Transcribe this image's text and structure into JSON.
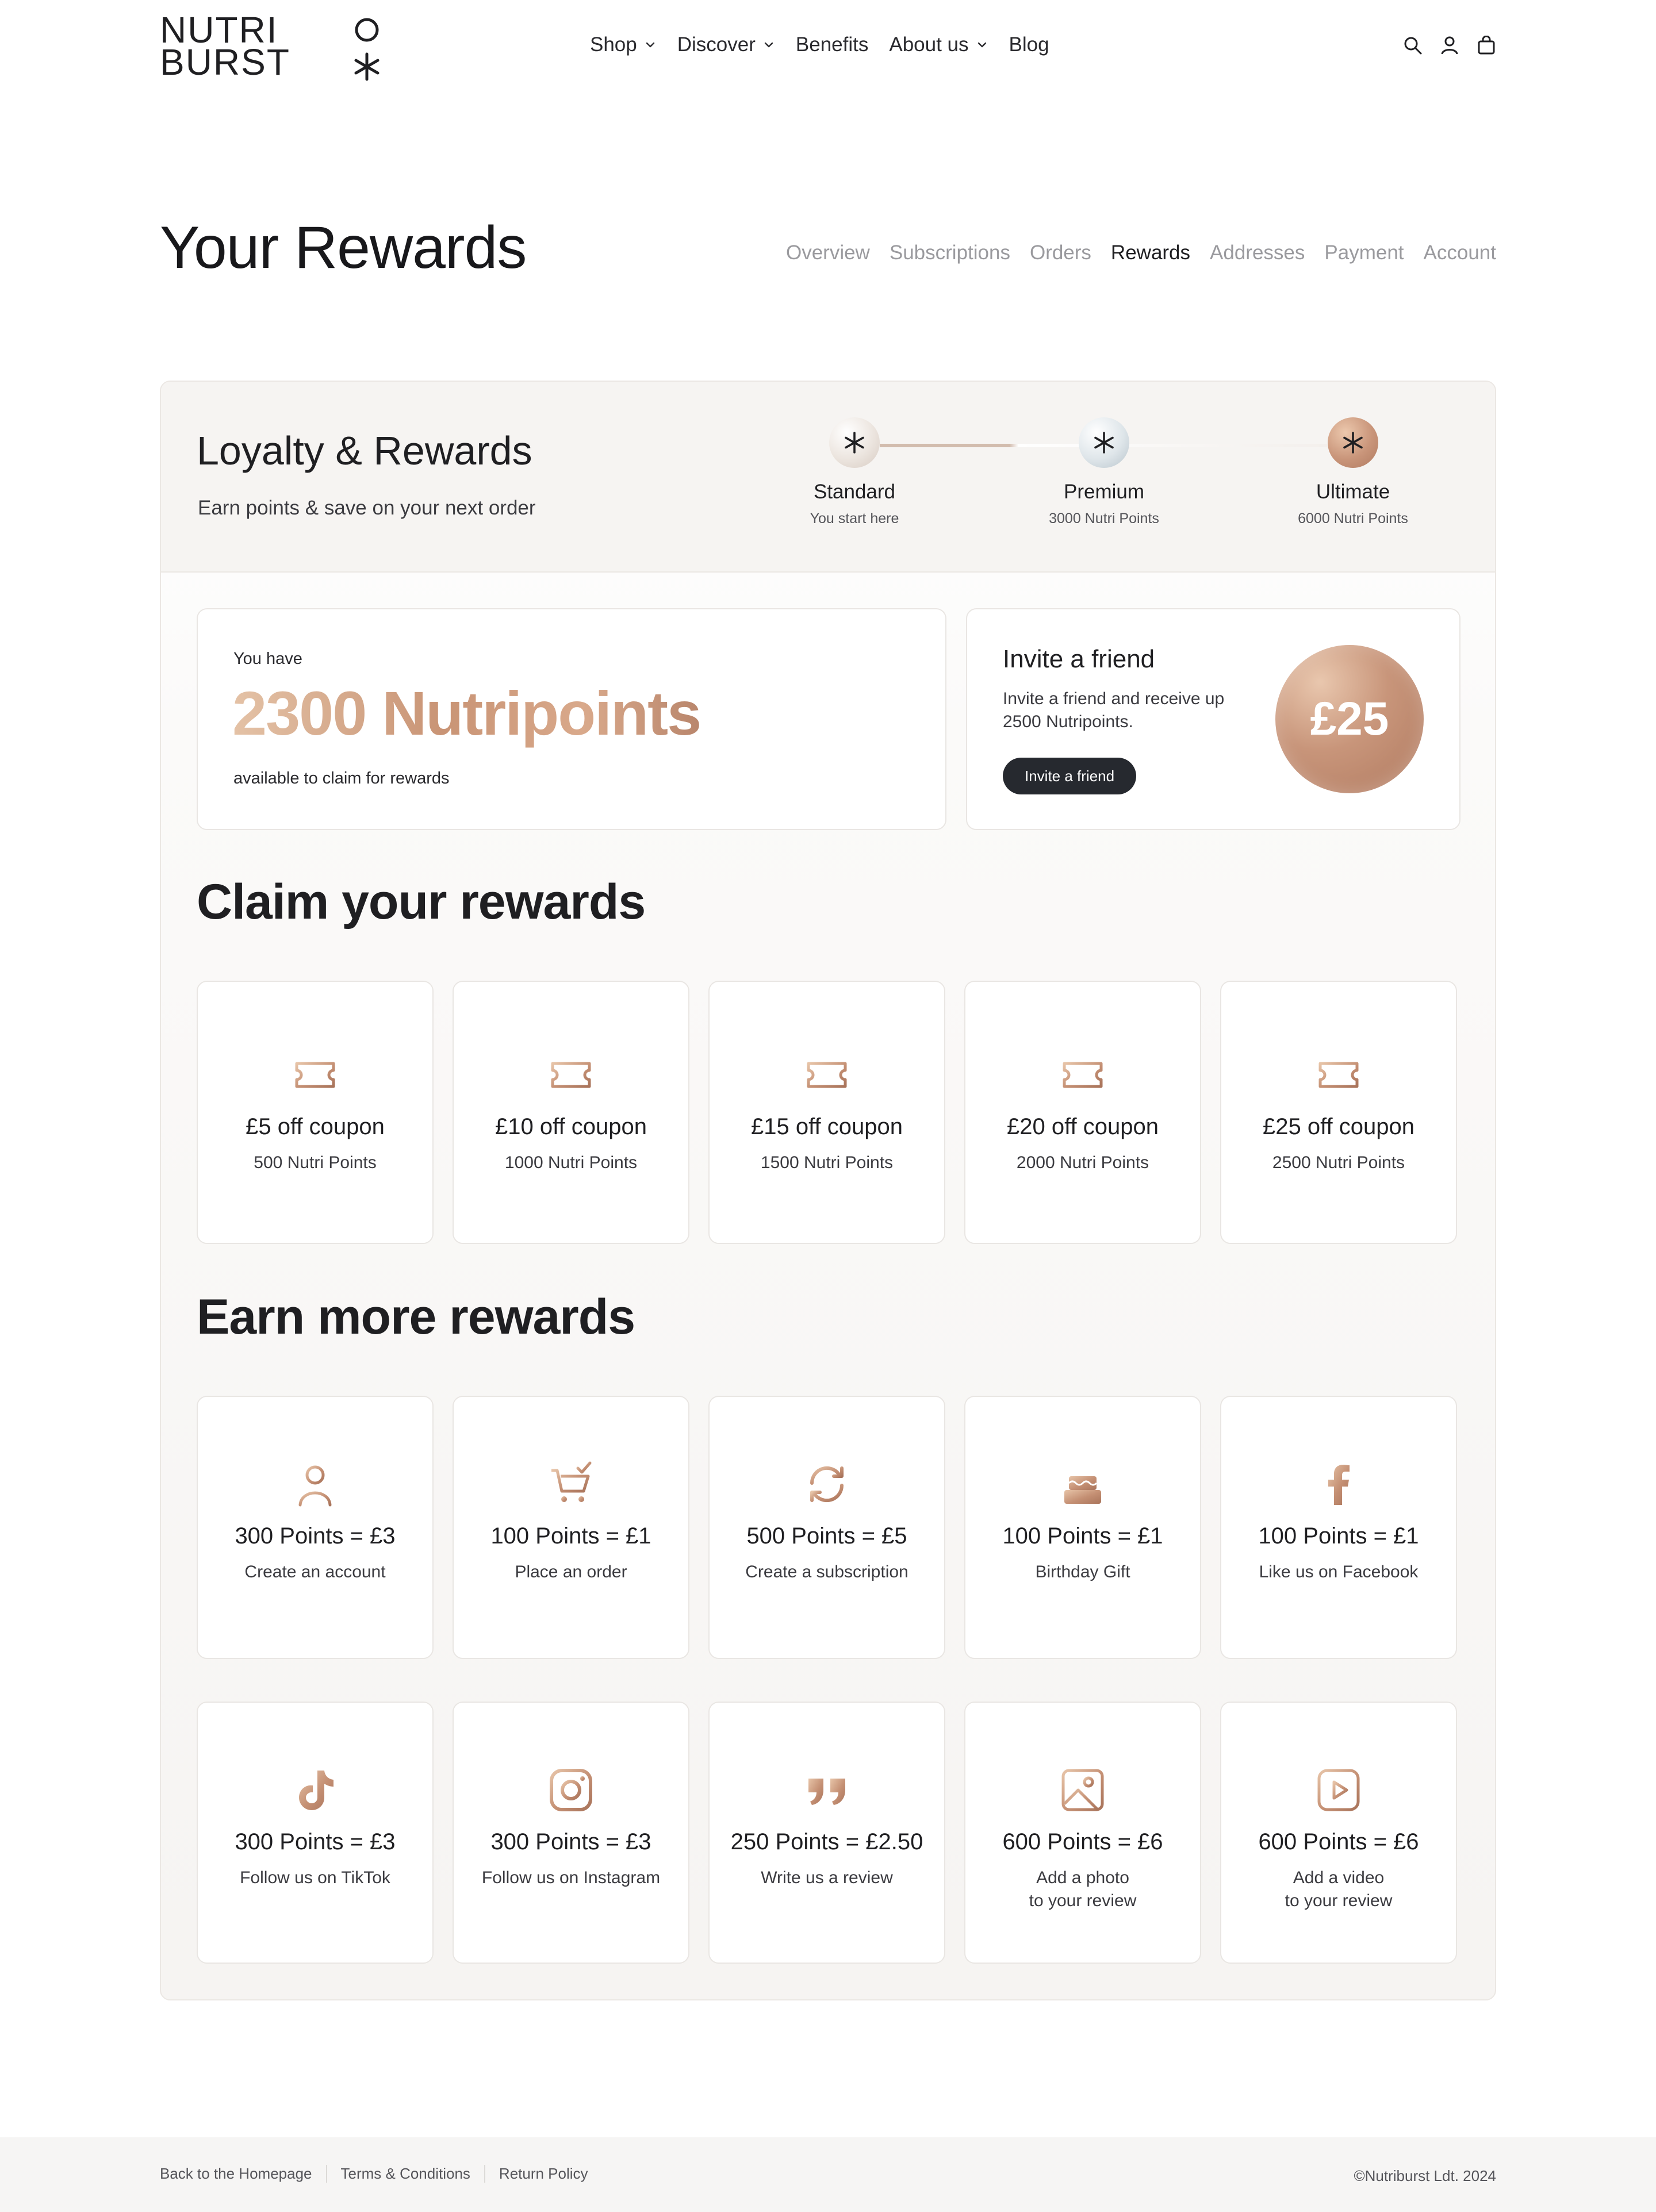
{
  "brand": {
    "line1": "NUTRI",
    "line2": "BURST"
  },
  "nav": {
    "items": [
      {
        "label": "Shop",
        "has_dropdown": true
      },
      {
        "label": "Discover",
        "has_dropdown": true
      },
      {
        "label": "Benefits",
        "has_dropdown": false
      },
      {
        "label": "About us",
        "has_dropdown": true
      },
      {
        "label": "Blog",
        "has_dropdown": false
      }
    ],
    "icons": [
      "search-icon",
      "account-icon",
      "cart-icon"
    ]
  },
  "page": {
    "title": "Your Rewards"
  },
  "tabs": {
    "items": [
      "Overview",
      "Subscriptions",
      "Orders",
      "Rewards",
      "Addresses",
      "Payment",
      "Account"
    ],
    "active": "Rewards"
  },
  "loyalty": {
    "title": "Loyalty & Rewards",
    "subtitle": "Earn points & save on your next order",
    "tiers": [
      {
        "name": "Standard",
        "sub": "You start here"
      },
      {
        "name": "Premium",
        "sub": "3000 Nutri Points"
      },
      {
        "name": "Ultimate",
        "sub": "6000 Nutri Points"
      }
    ]
  },
  "points": {
    "label_top": "You have",
    "value": "2300 Nutripoints",
    "label_bottom": "available to claim for rewards"
  },
  "invite": {
    "title": "Invite a friend",
    "text": "Invite a friend and receive up 2500 Nutripoints.",
    "button": "Invite a friend",
    "amount": "£25"
  },
  "claim": {
    "title": "Claim your rewards",
    "items": [
      {
        "title": "£5 off coupon",
        "sub": "500 Nutri Points",
        "icon": "ticket-icon"
      },
      {
        "title": "£10 off coupon",
        "sub": "1000 Nutri Points",
        "icon": "ticket-icon"
      },
      {
        "title": "£15 off coupon",
        "sub": "1500 Nutri Points",
        "icon": "ticket-icon"
      },
      {
        "title": "£20 off coupon",
        "sub": "2000 Nutri Points",
        "icon": "ticket-icon"
      },
      {
        "title": "£25 off coupon",
        "sub": "2500 Nutri Points",
        "icon": "ticket-icon"
      }
    ]
  },
  "earn": {
    "title": "Earn more rewards",
    "items": [
      {
        "title": "300 Points = £3",
        "sub": "Create an account",
        "icon": "user-icon"
      },
      {
        "title": "100 Points = £1",
        "sub": "Place an order",
        "icon": "cart-check-icon"
      },
      {
        "title": "500 Points = £5",
        "sub": "Create a subscription",
        "icon": "refresh-icon"
      },
      {
        "title": "100 Points = £1",
        "sub": "Birthday Gift",
        "icon": "cake-icon"
      },
      {
        "title": "100 Points = £1",
        "sub": "Like us on Facebook",
        "icon": "facebook-icon"
      },
      {
        "title": "300 Points = £3",
        "sub": "Follow us on TikTok",
        "icon": "tiktok-icon"
      },
      {
        "title": "300 Points = £3",
        "sub": "Follow us on Instagram",
        "icon": "instagram-icon"
      },
      {
        "title": "250 Points = £2.50",
        "sub": "Write us a review",
        "icon": "quote-icon"
      },
      {
        "title": "600 Points = £6",
        "sub": "Add a photo\nto your review",
        "icon": "photo-icon"
      },
      {
        "title": "600 Points = £6",
        "sub": "Add a video\nto your review",
        "icon": "video-icon"
      }
    ]
  },
  "footer": {
    "links": [
      "Back to the Homepage",
      "Terms & Conditions",
      "Return Policy"
    ],
    "copyright": "©Nutriburst Ldt. 2024"
  },
  "colors": {
    "accent": "#c8957a",
    "dark": "#26292f",
    "panel": "#f6f4f2",
    "muted": "#9a9a9e"
  }
}
